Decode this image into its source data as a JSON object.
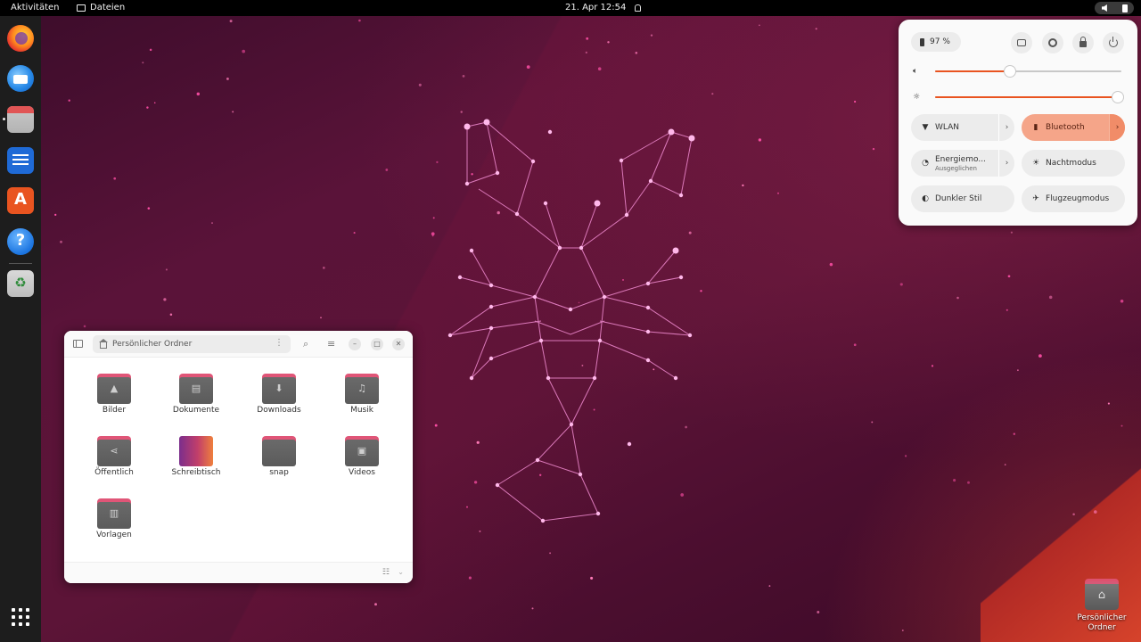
{
  "topbar": {
    "activities": "Aktivitäten",
    "app_menu": "Dateien",
    "clock": "21. Apr  12:54"
  },
  "dock": {
    "apps": [
      {
        "name": "Firefox",
        "icon": "firefox-icon"
      },
      {
        "name": "Thunderbird",
        "icon": "thunderbird-icon"
      },
      {
        "name": "Dateien",
        "icon": "files-icon",
        "running": true
      },
      {
        "name": "LibreOffice Writer",
        "icon": "writer-icon"
      },
      {
        "name": "Ubuntu Software",
        "icon": "app-center-icon"
      },
      {
        "name": "Hilfe",
        "icon": "help-icon"
      },
      {
        "name": "Papierkorb",
        "icon": "trash-icon"
      }
    ],
    "show_apps_icon": "grid-icon"
  },
  "quick_settings": {
    "battery": "97 %",
    "volume_level": 0.4,
    "brightness_level": 0.98,
    "toggles": [
      {
        "label": "WLAN",
        "sub": "",
        "icon": "wifi-icon",
        "active": false,
        "has_menu": true
      },
      {
        "label": "Bluetooth",
        "sub": "",
        "icon": "bluetooth-icon",
        "active": true,
        "has_menu": true
      },
      {
        "label": "Energiemo...",
        "sub": "Ausgeglichen",
        "icon": "power-mode-icon",
        "active": false,
        "has_menu": true
      },
      {
        "label": "Nachtmodus",
        "sub": "",
        "icon": "night-light-icon",
        "active": false,
        "has_menu": false
      },
      {
        "label": "Dunkler Stil",
        "sub": "",
        "icon": "dark-style-icon",
        "active": false,
        "has_menu": false
      },
      {
        "label": "Flugzeugmodus",
        "sub": "",
        "icon": "airplane-icon",
        "active": false,
        "has_menu": false
      }
    ],
    "accent": "#e95420"
  },
  "file_window": {
    "path": "Persönlicher Ordner",
    "items": [
      {
        "label": "Bilder",
        "glyph": "▲"
      },
      {
        "label": "Dokumente",
        "glyph": "▤"
      },
      {
        "label": "Downloads",
        "glyph": "⬇"
      },
      {
        "label": "Musik",
        "glyph": "♫"
      },
      {
        "label": "Öffentlich",
        "glyph": "⋖"
      },
      {
        "label": "Schreibtisch",
        "glyph": ""
      },
      {
        "label": "snap",
        "glyph": ""
      },
      {
        "label": "Videos",
        "glyph": "▣"
      },
      {
        "label": "Vorlagen",
        "glyph": "▥"
      }
    ]
  },
  "desktop": {
    "home_label_line1": "Persönlicher",
    "home_label_line2": "Ordner"
  }
}
